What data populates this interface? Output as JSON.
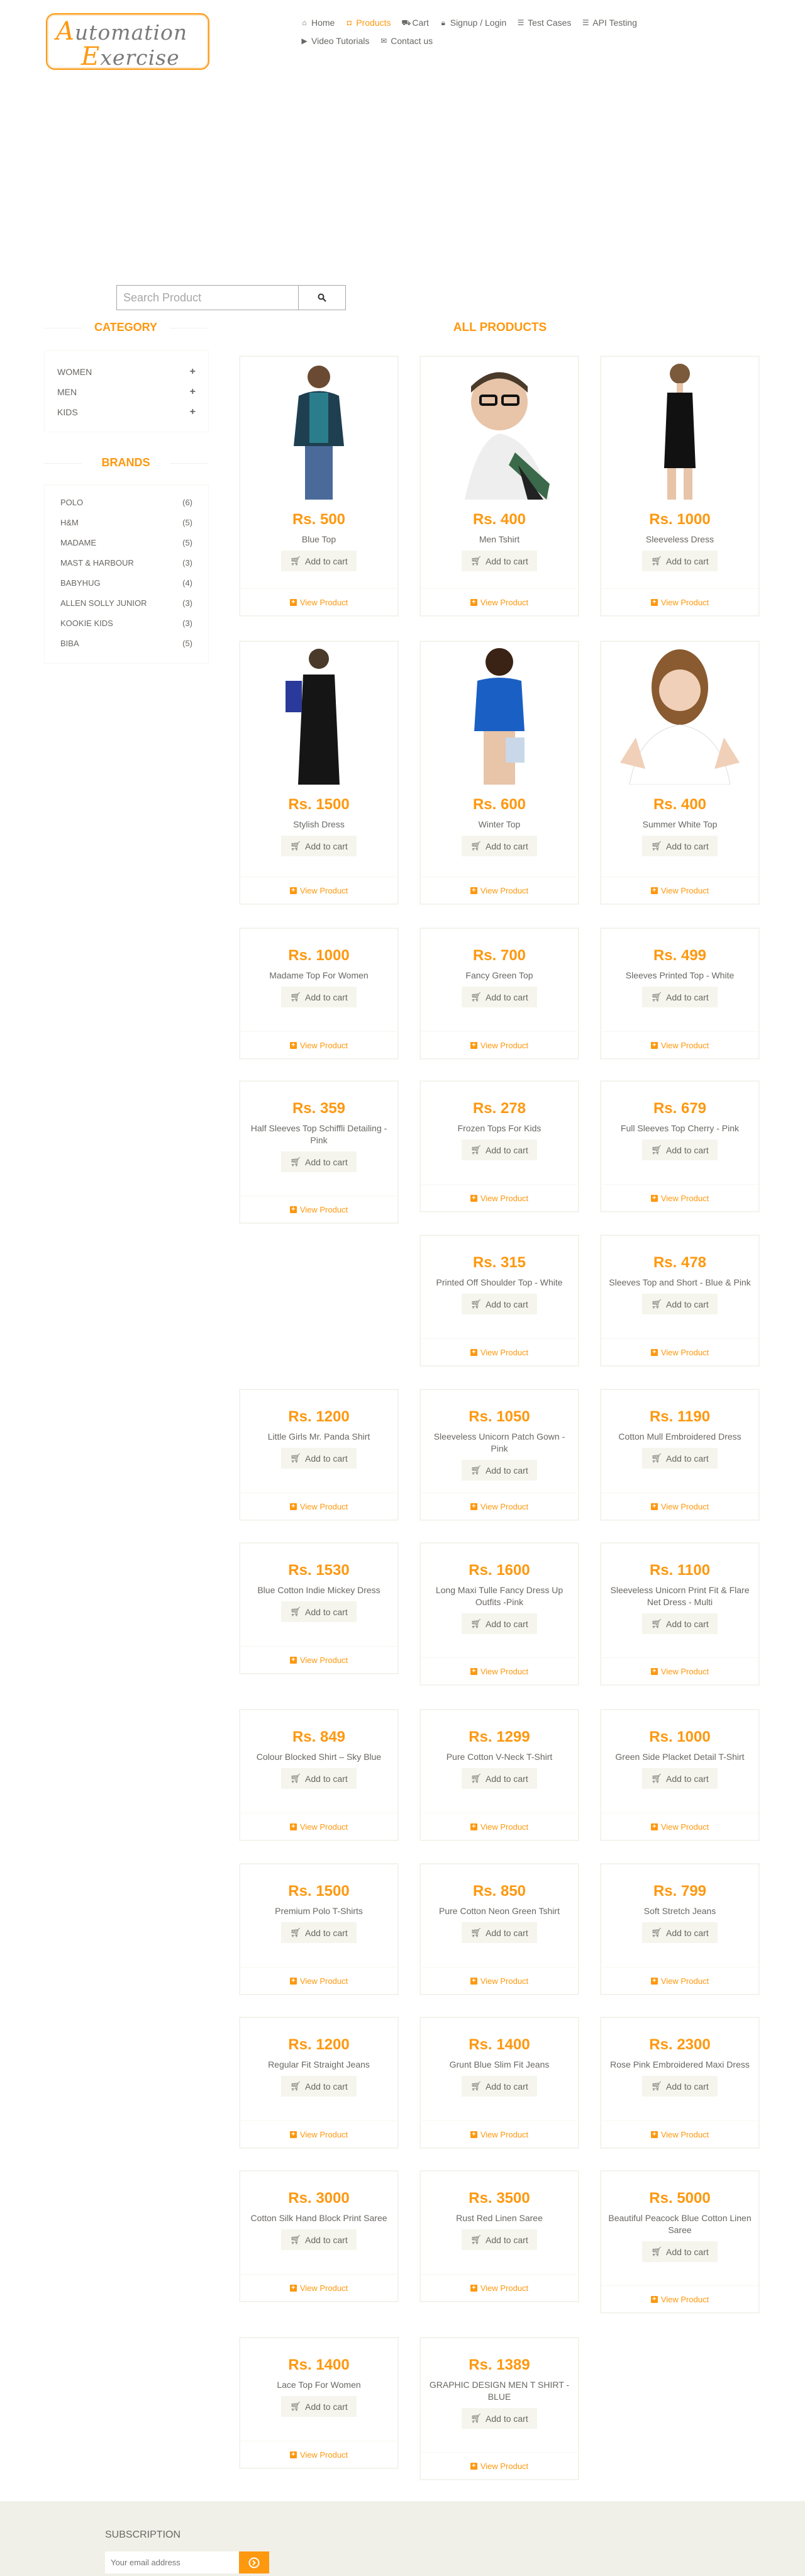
{
  "logo": {
    "line1_first": "A",
    "line1_rest": "utomation",
    "line2_first": "E",
    "line2_rest": "xercise"
  },
  "nav": [
    {
      "label": "Home",
      "icon": "home-icon"
    },
    {
      "label": "Products",
      "icon": "shirt-icon",
      "active": true
    },
    {
      "label": "Cart",
      "icon": "cart-icon"
    },
    {
      "label": "Signup / Login",
      "icon": "lock-icon"
    },
    {
      "label": "Test Cases",
      "icon": "list-icon"
    },
    {
      "label": "API Testing",
      "icon": "list-icon"
    },
    {
      "label": "Video Tutorials",
      "icon": "youtube-icon"
    },
    {
      "label": "Contact us",
      "icon": "envelope-icon"
    }
  ],
  "search": {
    "placeholder": "Search Product"
  },
  "sidebar": {
    "category_title": "Category",
    "categories": [
      "Women",
      "Men",
      "Kids"
    ],
    "brands_title": "Brands",
    "brands": [
      {
        "name": "Polo",
        "count": "(6)"
      },
      {
        "name": "H&M",
        "count": "(5)"
      },
      {
        "name": "Madame",
        "count": "(5)"
      },
      {
        "name": "Mast & Harbour",
        "count": "(3)"
      },
      {
        "name": "Babyhug",
        "count": "(4)"
      },
      {
        "name": "Allen Solly Junior",
        "count": "(3)"
      },
      {
        "name": "Kookie Kids",
        "count": "(3)"
      },
      {
        "name": "Biba",
        "count": "(5)"
      }
    ]
  },
  "products_title": "All Products",
  "add_label": "Add to cart",
  "view_label": "View Product",
  "products": [
    {
      "price": "Rs. 500",
      "name": "Blue Top"
    },
    {
      "price": "Rs. 400",
      "name": "Men Tshirt"
    },
    {
      "price": "Rs. 1000",
      "name": "Sleeveless Dress"
    },
    {
      "price": "Rs. 1500",
      "name": "Stylish Dress"
    },
    {
      "price": "Rs. 600",
      "name": "Winter Top"
    },
    {
      "price": "Rs. 400",
      "name": "Summer White Top"
    },
    {
      "price": "Rs. 1000",
      "name": "Madame Top For Women"
    },
    {
      "price": "Rs. 700",
      "name": "Fancy Green Top"
    },
    {
      "price": "Rs. 499",
      "name": "Sleeves Printed Top - White"
    },
    {
      "price": "Rs. 359",
      "name": "Half Sleeves Top Schiffli Detailing - Pink"
    },
    {
      "price": "Rs. 278",
      "name": "Frozen Tops For Kids"
    },
    {
      "price": "Rs. 679",
      "name": "Full Sleeves Top Cherry - Pink"
    },
    {
      "price": "Rs. 315",
      "name": "Printed Off Shoulder Top - White"
    },
    {
      "price": "Rs. 478",
      "name": "Sleeves Top and Short - Blue & Pink"
    },
    {
      "price": "Rs. 1200",
      "name": "Little Girls Mr. Panda Shirt"
    },
    {
      "price": "Rs. 1050",
      "name": "Sleeveless Unicorn Patch Gown - Pink"
    },
    {
      "price": "Rs. 1190",
      "name": "Cotton Mull Embroidered Dress"
    },
    {
      "price": "Rs. 1530",
      "name": "Blue Cotton Indie Mickey Dress"
    },
    {
      "price": "Rs. 1600",
      "name": "Long Maxi Tulle Fancy Dress Up Outfits -Pink"
    },
    {
      "price": "Rs. 1100",
      "name": "Sleeveless Unicorn Print Fit & Flare Net Dress - Multi"
    },
    {
      "price": "Rs. 849",
      "name": "Colour Blocked Shirt – Sky Blue"
    },
    {
      "price": "Rs. 1299",
      "name": "Pure Cotton V-Neck T-Shirt"
    },
    {
      "price": "Rs. 1000",
      "name": "Green Side Placket Detail T-Shirt"
    },
    {
      "price": "Rs. 1500",
      "name": "Premium Polo T-Shirts"
    },
    {
      "price": "Rs. 850",
      "name": "Pure Cotton Neon Green Tshirt"
    },
    {
      "price": "Rs. 799",
      "name": "Soft Stretch Jeans"
    },
    {
      "price": "Rs. 1200",
      "name": "Regular Fit Straight Jeans"
    },
    {
      "price": "Rs. 1400",
      "name": "Grunt Blue Slim Fit Jeans"
    },
    {
      "price": "Rs. 2300",
      "name": "Rose Pink Embroidered Maxi Dress"
    },
    {
      "price": "Rs. 3000",
      "name": "Cotton Silk Hand Block Print Saree"
    },
    {
      "price": "Rs. 3500",
      "name": "Rust Red Linen Saree"
    },
    {
      "price": "Rs. 5000",
      "name": "Beautiful Peacock Blue Cotton Linen Saree"
    },
    {
      "price": "Rs. 1400",
      "name": "Lace Top For Women"
    },
    {
      "price": "Rs. 1389",
      "name": "GRAPHIC DESIGN MEN T SHIRT - BLUE"
    }
  ],
  "footer": {
    "subscription_title": "Subscription",
    "email_placeholder": "Your email address"
  },
  "colors": {
    "accent": "#FE980F",
    "text": "#696763",
    "footer_bg": "#F0F0E9"
  }
}
